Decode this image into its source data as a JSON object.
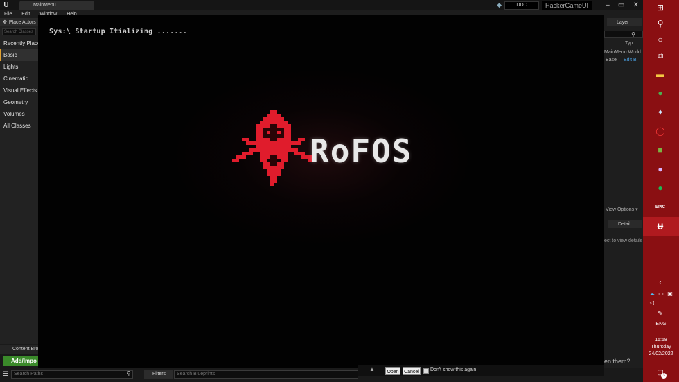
{
  "editor": {
    "logo": "U",
    "tab_title": "MainMenu",
    "ddc_label": "DDC",
    "game_name": "HackerGameUI",
    "menu": [
      "File",
      "Edit",
      "Window",
      "Help"
    ]
  },
  "left_panel": {
    "header": "Place Actors",
    "search_placeholder": "Search Classes",
    "categories": [
      "Recently Placed",
      "Basic",
      "Lights",
      "Cinematic",
      "Visual Effects",
      "Geometry",
      "Volumes",
      "All Classes"
    ],
    "active_category": "Basic"
  },
  "right_panel": {
    "layers_tab": "Layer",
    "type_label": "Typ",
    "world_row": "MainMenu World",
    "base_row": "Base",
    "edit_link": "Edit B",
    "view_options": "View Options",
    "details_tab": "Detail",
    "select_hint": "ect to view details",
    "them_text": "en them?"
  },
  "viewport": {
    "startup_text": "Sys:\\ Startup Itializing .......",
    "brand_name": "RoFOS",
    "accent_color": "#e01c2c"
  },
  "content_browser": {
    "tab_label": "Content Bro",
    "add_import": "Add/Impo",
    "search_paths_placeholder": "Search Paths",
    "filters_label": "Filters",
    "search_blueprints_placeholder": "Search Blueprints"
  },
  "dialog": {
    "open_label": "Open",
    "cancel_label": "Cancel",
    "dont_show_label": "Don't show this again"
  },
  "taskbar": {
    "language": "ENG",
    "time": "15:58",
    "day": "Thursday",
    "date": "24/02/2022",
    "notification_count": "3",
    "bg_color": "#8a0f12"
  }
}
